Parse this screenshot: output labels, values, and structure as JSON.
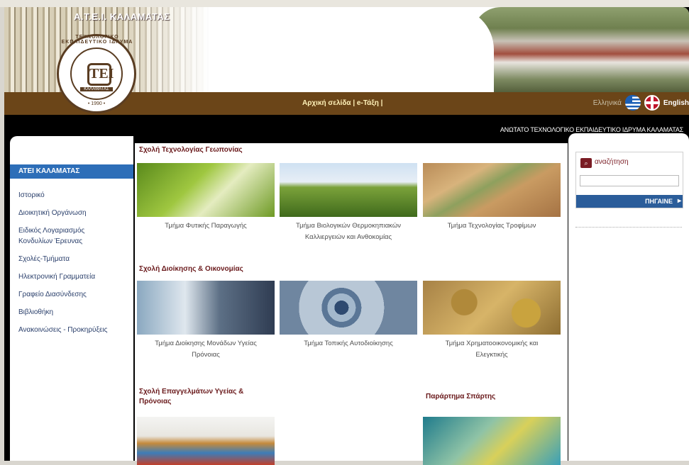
{
  "header": {
    "site_title": "Α.Τ.Ε.Ι. ΚΑΛΑΜΑΤΑΣ",
    "logo": {
      "ring_text": "ΤΕΧΝΟΛΟΓΙΚΟ ΕΚΠΑΙΔΕΥΤΙΚΟ ΙΔΡΥΜΑ",
      "mark": "ΤΕΙ",
      "label": "ΚΑΛΑΜΑΤΑΣ",
      "year": "• 1990 •"
    }
  },
  "nav": {
    "home": "Αρχική σελίδα",
    "separator": "|",
    "etaxi": "e-Τάξη",
    "trailing": "|",
    "lang_gr": "Ελληνικά",
    "lang_en": "English"
  },
  "institution_name": "ΑΝΩΤΑΤΟ ΤΕΧΝΟΛΟΓΙΚΟ ΕΚΠΑΙΔΕΥΤΙΚΟ ΙΔΡΥΜΑ ΚΑΛΑΜΑΤΑΣ",
  "sidebar": {
    "heading": "ΑΤΕΙ ΚΑΛΑΜΑΤΑΣ",
    "items": [
      "Ιστορικό",
      "Διοικητική Οργάνωση",
      "Ειδικός Λογαριασμός Κονδυλίων Έρευνας",
      "Σχολές-Τμήματα",
      "Ηλεκτρονική Γραμματεία",
      "Γραφείο Διασύνδεσης",
      "Βιβλιοθήκη",
      "Ανακοινώσεις - Προκηρύξεις"
    ]
  },
  "search": {
    "title": "αναζήτηση",
    "value": "",
    "button": "ΠΗΓΑΙΝΕ"
  },
  "sections": [
    {
      "title": "Σχολή Τεχνολογίας Γεωπονίας",
      "departments": [
        "Τμήμα Φυτικής Παραγωγής",
        "Τμήμα Βιολογικών Θερμοκηπιακών Καλλιεργειών και Ανθοκομίας",
        "Τμήμα Τεχνολογίας Τροφίμων"
      ]
    },
    {
      "title": "Σχολή Διοίκησης & Οικονομίας",
      "departments": [
        "Τμήμα Διοίκησης Μονάδων Υγείας Πρόνοιας",
        "Τμήμα Τοπικής Αυτοδιοίκησης",
        "Τμήμα Χρηματοοικονομικής και Ελεγκτικής"
      ]
    },
    {
      "title": "Σχολή Επαγγελμάτων Υγείας & Πρόνοιας",
      "departments": []
    },
    {
      "title": "Παράρτημα Σπάρτης",
      "departments": []
    }
  ]
}
